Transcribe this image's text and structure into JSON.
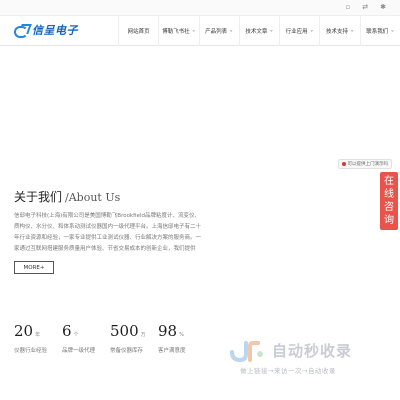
{
  "topbar": {
    "icons": [
      "home-icon",
      "share-icon",
      "weibo-icon"
    ],
    "glyphs": [
      "▫",
      "⇄",
      "✱"
    ]
  },
  "logo": {
    "text": "信呈电子"
  },
  "nav": {
    "items": [
      {
        "label": "网站首页",
        "has_dropdown": false
      },
      {
        "label": "博勒飞书社",
        "has_dropdown": true
      },
      {
        "label": "产品列表",
        "has_dropdown": true
      },
      {
        "label": "技术文章",
        "has_dropdown": true
      },
      {
        "label": "行业应用",
        "has_dropdown": true
      },
      {
        "label": "技术支持",
        "has_dropdown": true
      },
      {
        "label": "联系我们",
        "has_dropdown": true
      }
    ]
  },
  "side": {
    "tag_text": "可以提供上门演示吗",
    "consult_chars": [
      "在",
      "线",
      "咨",
      "询"
    ]
  },
  "about": {
    "title_cn": "关于我们",
    "title_en": "/About Us",
    "text": "信邸电子科技(上海)有限公司是美国博勒飞Brookfield品牌粘度计、流变仪、质构仪、水分仪、和体系动测试仪器国内一级代理平台。上海信邸电子有二十年行业资源和经验，一家专业提供工业测试仪器、行业解决方案的服务商。一家通过互联网搭建服务质量用户体验、节省交易成本的创新企业，我们提供规...",
    "more_label": "MORE+"
  },
  "stats": [
    {
      "num": "20",
      "unit": "年",
      "label": "仪器行业经验"
    },
    {
      "num": "6",
      "unit": "个",
      "label": "品牌一级代理"
    },
    {
      "num": "500",
      "unit": "万",
      "label": "常备仪器库存"
    },
    {
      "num": "98",
      "unit": "%",
      "label": "客户满意度"
    }
  ],
  "watermark": {
    "main": "自动秒收录",
    "sub": "做上链接→来访一次→自动收录"
  },
  "colors": {
    "brand": "#1565c0",
    "consult": "#e8544c"
  }
}
